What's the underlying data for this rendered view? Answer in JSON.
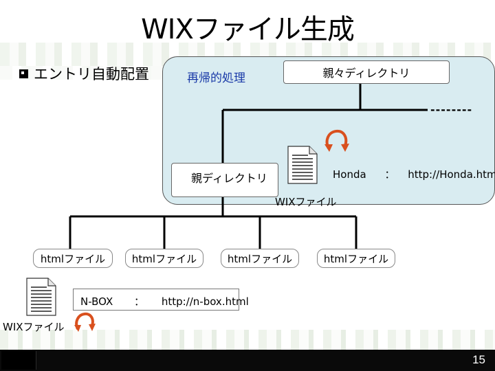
{
  "slide": {
    "title": "WIXファイル生成",
    "bullet": "エントリ自動配置",
    "recursive_label": "再帰的処理",
    "grandparent_dir": "親々ディレクトリ",
    "parent_dir": "親ディレクトリ",
    "dashes": "--------",
    "honda": {
      "name": "Honda",
      "sep": "：",
      "link": "http://Honda.html"
    },
    "wix_file_label_1": "WIXファイル",
    "html_files": [
      "htmlファイル",
      "htmlファイル",
      "htmlファイル",
      "htmlファイル"
    ],
    "nbox": {
      "name": "N-BOX",
      "sep": "：",
      "link": "http://n-box.html"
    },
    "wix_file_label_2": "WIXファイル",
    "page_number": "15"
  },
  "icons": {
    "document": "document-icon",
    "cycle_arrow": "cycle-arrow-icon",
    "bullet": "square-bullet-icon"
  },
  "colors": {
    "panel": "#d9ecf1",
    "recursive_text": "#1a3aa8",
    "arrow": "#d9501e",
    "footer": "#0a0a0a"
  }
}
